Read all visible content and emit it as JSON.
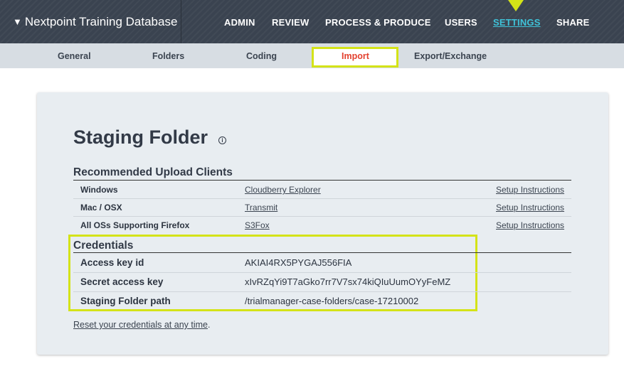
{
  "header": {
    "brand_arrow": "▼",
    "brand": "Nextpoint Training Database",
    "nav": {
      "admin": "ADMIN",
      "review": "REVIEW",
      "process": "PROCESS & PRODUCE",
      "users": "USERS",
      "settings": "SETTINGS",
      "share": "SHARE"
    },
    "highlight_color": "#d4e318",
    "active_color": "#3fc3d9"
  },
  "subnav": {
    "general": "General",
    "folders": "Folders",
    "coding": "Coding",
    "import": "Import",
    "export": "Export/Exchange"
  },
  "page": {
    "title": "Staging Folder",
    "info_glyph": "i"
  },
  "upload_clients": {
    "heading": "Recommended Upload Clients",
    "rows": [
      {
        "os": "Windows",
        "client": "Cloudberry Explorer",
        "setup": "Setup Instructions"
      },
      {
        "os": "Mac / OSX",
        "client": "Transmit",
        "setup": "Setup Instructions"
      },
      {
        "os": "All OSs Supporting Firefox",
        "client": "S3Fox",
        "setup": "Setup Instructions"
      }
    ]
  },
  "credentials": {
    "heading": "Credentials",
    "rows": [
      {
        "label": "Access key id",
        "value": "AKIAI4RX5PYGAJ556FIA"
      },
      {
        "label": "Secret access key",
        "value": "xIvRZqYi9T7aGko7rr7V7sx74kiQIuUumOYyFeMZ"
      },
      {
        "label": "Staging Folder path",
        "value": "/trialmanager-case-folders/case-17210002"
      }
    ]
  },
  "reset": {
    "link_text": "Reset your credentials at any time",
    "suffix": "."
  }
}
